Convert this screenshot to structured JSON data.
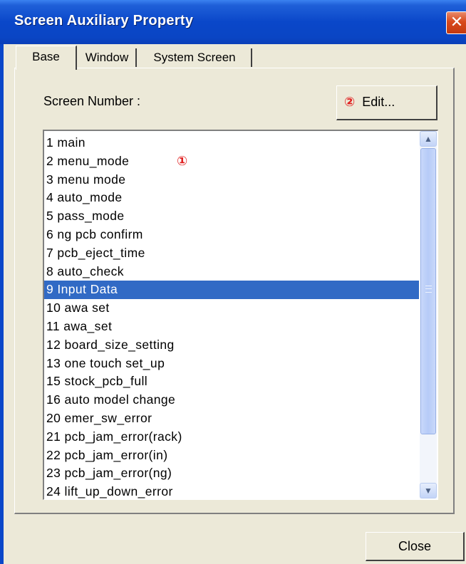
{
  "window": {
    "title": "Screen Auxiliary Property",
    "close_glyph": "✕"
  },
  "tabs": [
    {
      "label": "Base",
      "active": true
    },
    {
      "label": "Window",
      "active": false
    },
    {
      "label": "System Screen",
      "active": false
    }
  ],
  "base": {
    "screen_number_label": "Screen Number :",
    "edit_button": {
      "marker": "②",
      "label": "Edit..."
    },
    "list_marker": "①",
    "screens": [
      "1 main",
      "2 menu_mode",
      "3 menu mode",
      "4 auto_mode",
      "5 pass_mode",
      "6 ng pcb confirm",
      "7 pcb_eject_time",
      "8 auto_check",
      "9 Input Data",
      "10 awa set",
      "11 awa_set",
      "12 board_size_setting",
      "13 one touch set_up",
      "15 stock_pcb_full",
      "16 auto model change",
      "20 emer_sw_error",
      "21 pcb_jam_error(rack)",
      "22 pcb_jam_error(in)",
      "23 pcb_jam_error(ng)",
      "24 lift_up_down_error"
    ],
    "selected_screen": "9 Input Data"
  },
  "footer": {
    "close_label": "Close"
  },
  "icons": {
    "scroll_up": "chevron-up-icon",
    "scroll_down": "chevron-down-icon",
    "window_close": "close-icon"
  },
  "colors": {
    "titlebar": "#0a47c9",
    "selection": "#316ac5",
    "dialog_bg": "#ece9d8",
    "marker": "#e02020"
  }
}
